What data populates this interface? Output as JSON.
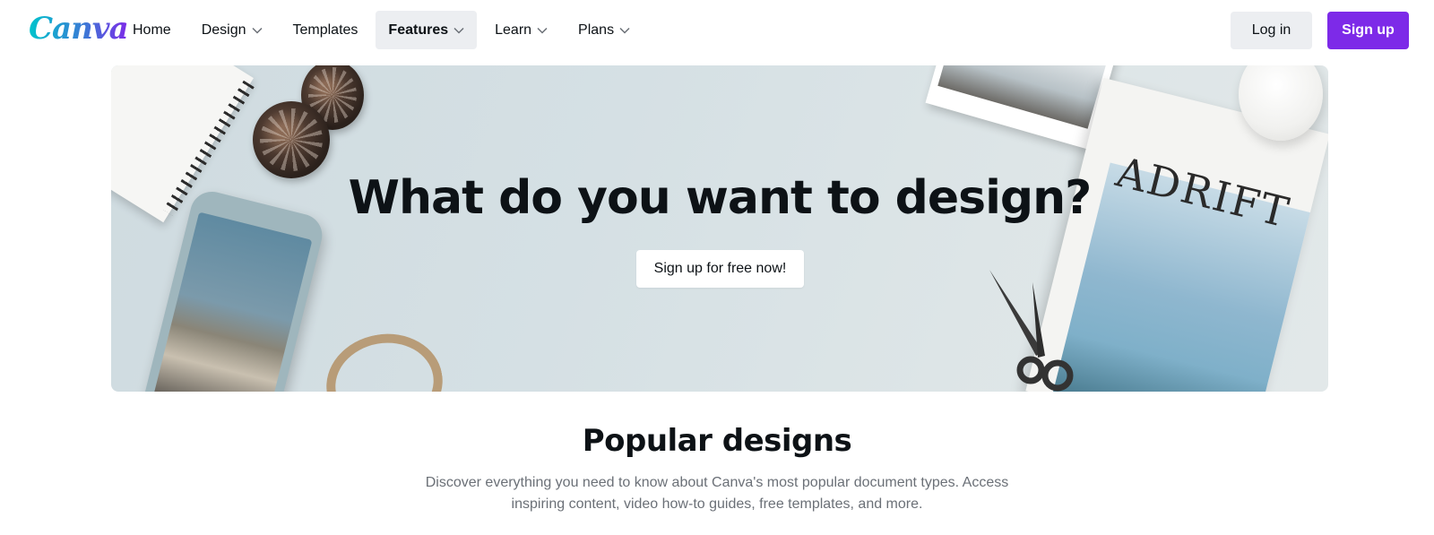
{
  "brand": {
    "name": "Canva",
    "accent": "#7d2ae8",
    "logo_gradient": [
      "#00c4cc",
      "#3a7bd5",
      "#7d2ae8"
    ]
  },
  "nav": {
    "items": [
      {
        "label": "Home",
        "has_dropdown": false,
        "active": false
      },
      {
        "label": "Design",
        "has_dropdown": true,
        "active": false
      },
      {
        "label": "Templates",
        "has_dropdown": false,
        "active": false
      },
      {
        "label": "Features",
        "has_dropdown": true,
        "active": true
      },
      {
        "label": "Learn",
        "has_dropdown": true,
        "active": false
      },
      {
        "label": "Plans",
        "has_dropdown": true,
        "active": false
      }
    ]
  },
  "auth": {
    "login_label": "Log in",
    "signup_label": "Sign up"
  },
  "hero": {
    "title": "What do you want to design?",
    "cta_label": "Sign up for free now!",
    "magazine_title": "ADRIFT",
    "background": "#d5e0e4"
  },
  "popular": {
    "title": "Popular designs",
    "description": "Discover everything you need to know about Canva's most popular document types. Access inspiring content, video how-to guides, free templates, and more."
  },
  "icons": {
    "dropdown": "chevron-down-icon"
  }
}
